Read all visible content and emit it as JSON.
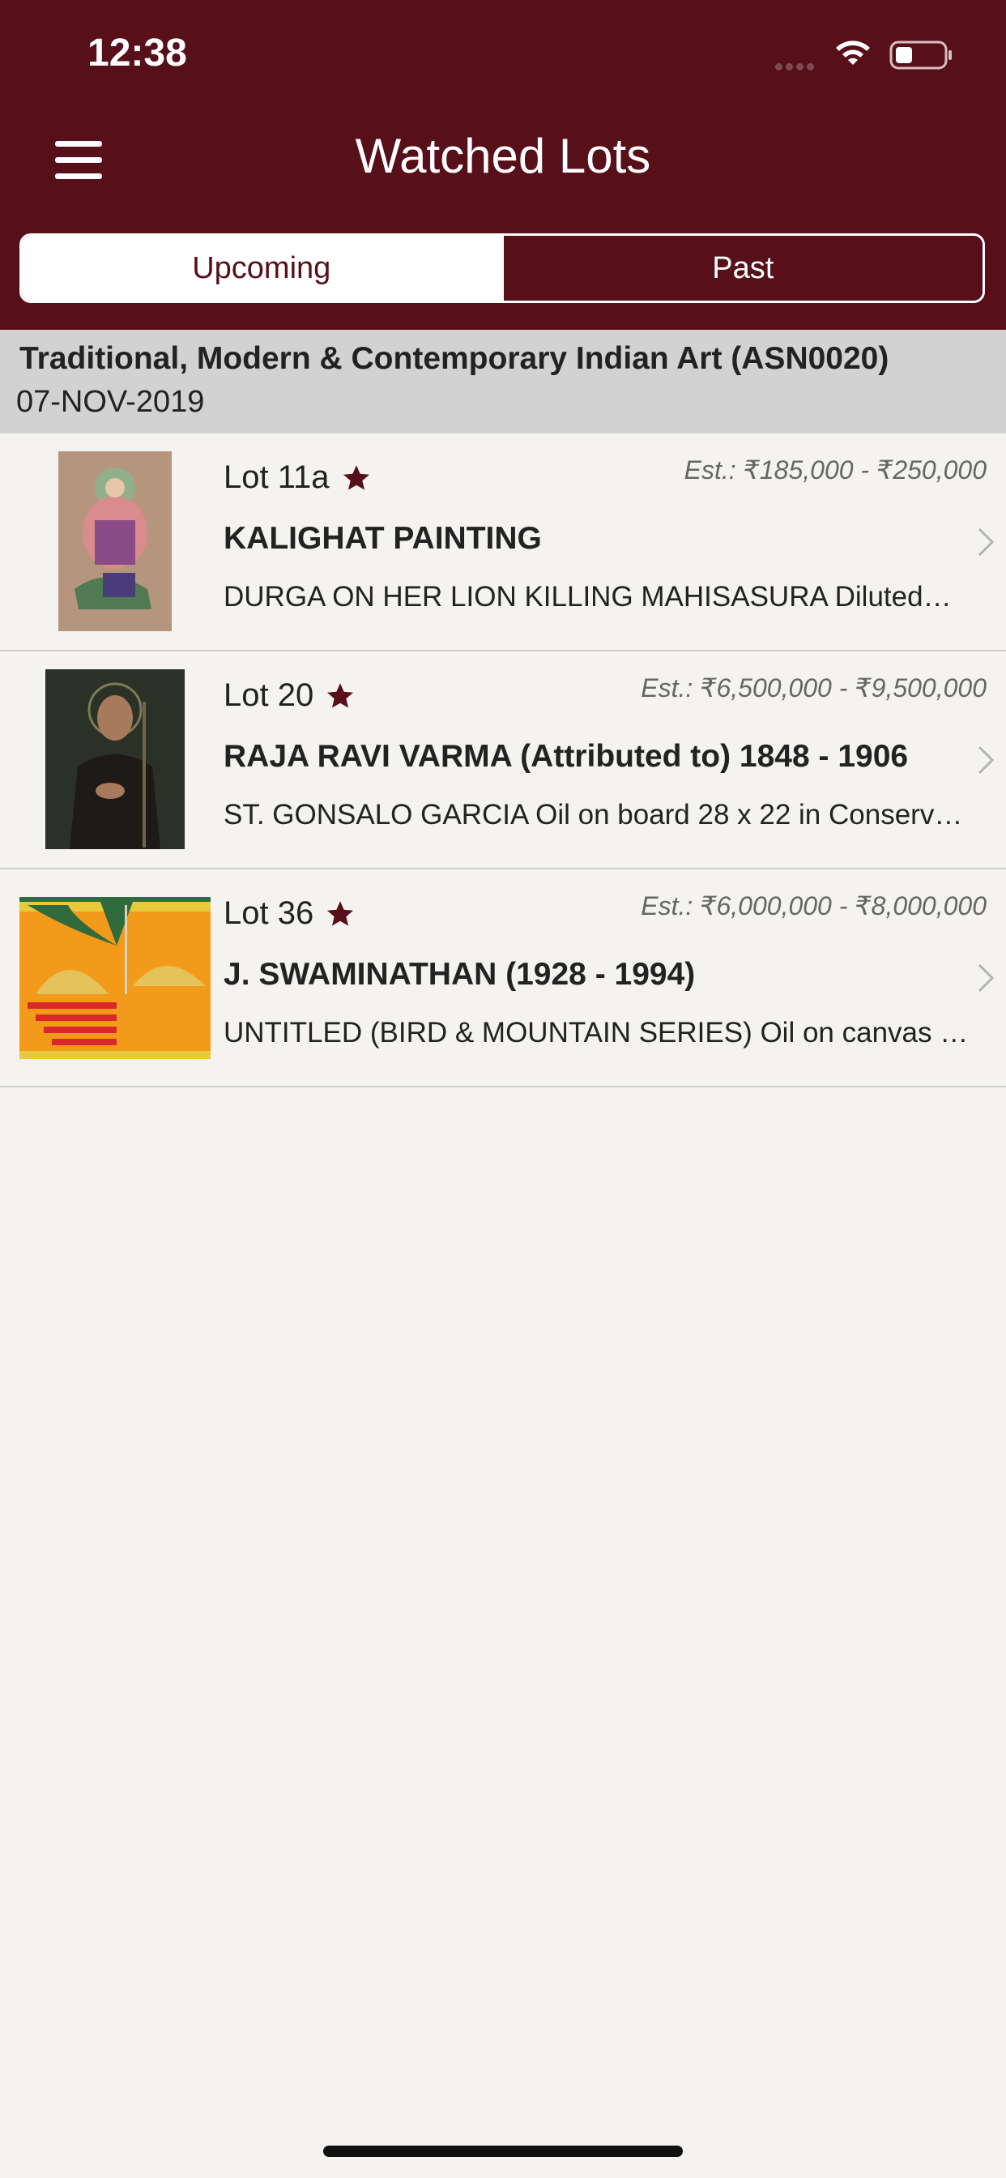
{
  "status_bar": {
    "time": "12:38"
  },
  "header": {
    "title": "Watched Lots",
    "tabs": [
      {
        "label": "Upcoming",
        "selected": true
      },
      {
        "label": "Past",
        "selected": false
      }
    ]
  },
  "section": {
    "title": "Traditional, Modern & Contemporary Indian Art (ASN0020)",
    "date": "07-NOV-2019"
  },
  "lots": [
    {
      "lot": "Lot 11a",
      "estimate": "Est.: ₹185,000 - ₹250,000",
      "artist": "KALIGHAT PAINTING",
      "description": "DURGA ON HER LION KILLING MAHISASURA Diluted…"
    },
    {
      "lot": "Lot 20",
      "estimate": "Est.: ₹6,500,000 - ₹9,500,000",
      "artist": "RAJA RAVI VARMA (Attributed to) 1848 - 1906",
      "description": "ST. GONSALO GARCIA Oil on board 28 x 22 in Conserv…"
    },
    {
      "lot": "Lot 36",
      "estimate": "Est.: ₹6,000,000 - ₹8,000,000",
      "artist": "J. SWAMINATHAN (1928 - 1994)",
      "description": "UNTITLED (BIRD & MOUNTAIN SERIES) Oil on canvas S…"
    }
  ],
  "colors": {
    "brand": "#570f19",
    "section_bg": "#d2d2d2",
    "page_bg": "#f4f3f0"
  },
  "icons": [
    "menu-icon",
    "star-icon",
    "chevron-right-icon",
    "wifi-icon",
    "battery-icon"
  ]
}
